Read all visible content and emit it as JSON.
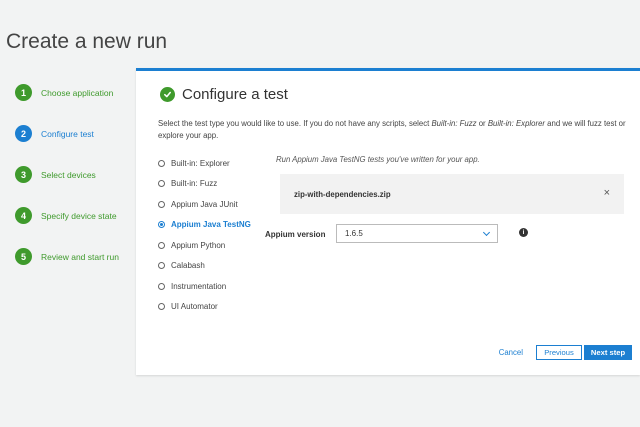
{
  "page": {
    "title": "Create a new run"
  },
  "steps": [
    {
      "num": "1",
      "label": "Choose application",
      "state": "done"
    },
    {
      "num": "2",
      "label": "Configure test",
      "state": "current"
    },
    {
      "num": "3",
      "label": "Select devices",
      "state": "done"
    },
    {
      "num": "4",
      "label": "Specify device state",
      "state": "done"
    },
    {
      "num": "5",
      "label": "Review and start run",
      "state": "done"
    }
  ],
  "panel": {
    "title": "Configure a test",
    "desc_1": "Select the test type you would like to use. If you do not have any scripts, select ",
    "desc_em1": "Built-in: Fuzz",
    "desc_2": " or ",
    "desc_em2": "Built-in: Explorer",
    "desc_3": " and we will fuzz test or explore your app."
  },
  "test_types": [
    {
      "label": "Built-in: Explorer",
      "selected": false
    },
    {
      "label": "Built-in: Fuzz",
      "selected": false
    },
    {
      "label": "Appium Java JUnit",
      "selected": false
    },
    {
      "label": "Appium Java TestNG",
      "selected": true
    },
    {
      "label": "Appium Python",
      "selected": false
    },
    {
      "label": "Calabash",
      "selected": false
    },
    {
      "label": "Instrumentation",
      "selected": false
    },
    {
      "label": "UI Automator",
      "selected": false
    }
  ],
  "config": {
    "run_desc": "Run Appium Java TestNG tests you've written for your app.",
    "file_name": "zip-with-dependencies.zip",
    "close_glyph": "×",
    "version_label": "Appium version",
    "version_value": "1.6.5",
    "info_glyph": "i"
  },
  "footer": {
    "cancel": "Cancel",
    "previous": "Previous",
    "next": "Next step"
  },
  "colors": {
    "accent": "#1c7fd1",
    "success": "#3f9a2c",
    "background": "#f2f3f3"
  }
}
